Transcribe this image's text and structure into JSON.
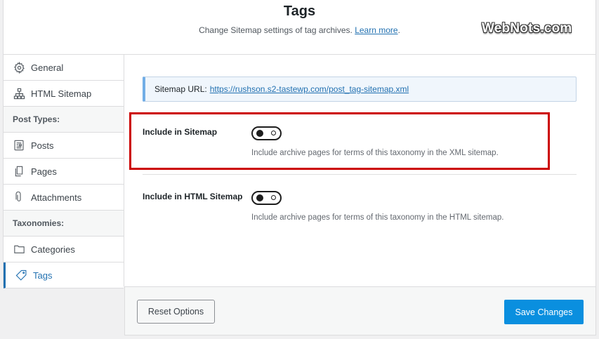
{
  "header": {
    "title": "Tags",
    "subtitle": "Change Sitemap settings of tag archives.",
    "learn_more": "Learn more",
    "subtitle_end": ".",
    "watermark": "WebNots.com"
  },
  "sidebar": {
    "items": [
      {
        "type": "item",
        "label": "General",
        "icon": "gear-icon"
      },
      {
        "type": "item",
        "label": "HTML Sitemap",
        "icon": "sitemap-icon"
      },
      {
        "type": "section",
        "label": "Post Types:"
      },
      {
        "type": "item",
        "label": "Posts",
        "icon": "post-icon"
      },
      {
        "type": "item",
        "label": "Pages",
        "icon": "page-icon"
      },
      {
        "type": "item",
        "label": "Attachments",
        "icon": "paperclip-icon"
      },
      {
        "type": "section",
        "label": "Taxonomies:"
      },
      {
        "type": "item",
        "label": "Categories",
        "icon": "folder-icon"
      },
      {
        "type": "item",
        "label": "Tags",
        "icon": "tag-icon",
        "active": true
      }
    ]
  },
  "main": {
    "sitemap_url_label": "Sitemap URL:",
    "sitemap_url": "https://rushson.s2-tastewp.com/post_tag-sitemap.xml",
    "settings": [
      {
        "label": "Include in Sitemap",
        "description": "Include archive pages for terms of this taxonomy in the XML sitemap.",
        "enabled": false
      },
      {
        "label": "Include in HTML Sitemap",
        "description": "Include archive pages for terms of this taxonomy in the HTML sitemap.",
        "enabled": false
      }
    ]
  },
  "footer": {
    "reset_label": "Reset Options",
    "save_label": "Save Changes"
  },
  "colors": {
    "accent": "#2271b1",
    "save_button": "#0a8fdf",
    "highlight_box": "#cc0000"
  }
}
